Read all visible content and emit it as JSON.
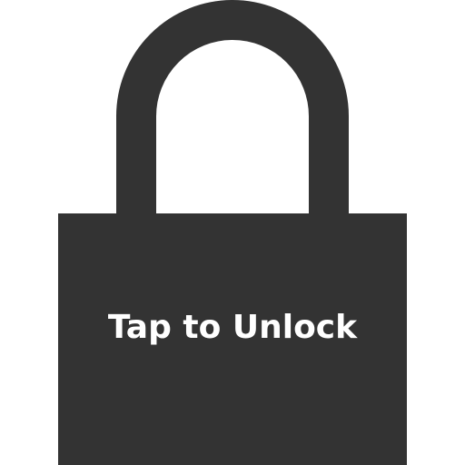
{
  "lock_screen": {
    "action_label": "Tap to Unlock",
    "icon": "padlock-icon"
  },
  "colors": {
    "lock_body": "#333333",
    "background": "#ffffff",
    "label_text": "#ffffff"
  }
}
